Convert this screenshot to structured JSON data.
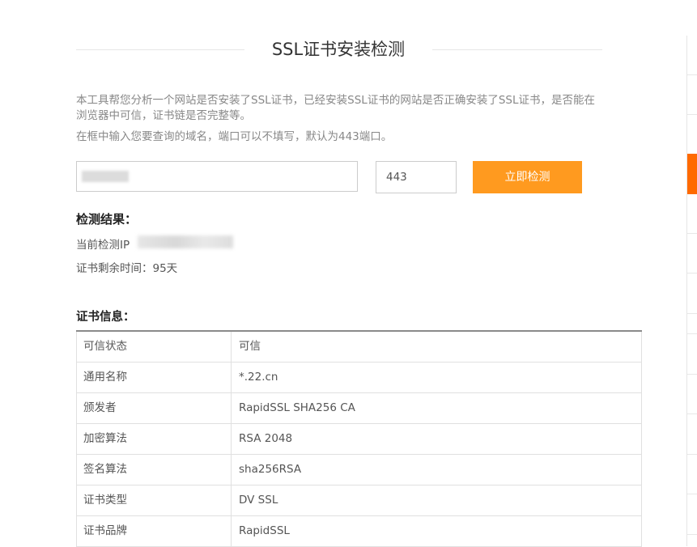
{
  "header": {
    "title": "SSL证书安装检测"
  },
  "intro": {
    "line1": "本工具帮您分析一个网站是否安装了SSL证书，已经安装SSL证书的网站是否正确安装了SSL证书，是否能在浏览器中可信，证书链是否完整等。",
    "line2": "在框中输入您要查询的域名，端口可以不填写，默认为443端口。"
  },
  "form": {
    "port_value": "443",
    "button_label": "立即检测"
  },
  "result": {
    "title": "检测结果：",
    "ip_label": "当前检测IP",
    "remaining": "证书剩余时间：95天"
  },
  "cert": {
    "title": "证书信息：",
    "rows": [
      {
        "key": "可信状态",
        "value": "可信"
      },
      {
        "key": "通用名称",
        "value": "*.22.cn"
      },
      {
        "key": "颁发者",
        "value": "RapidSSL SHA256 CA"
      },
      {
        "key": "加密算法",
        "value": "RSA 2048"
      },
      {
        "key": "签名算法",
        "value": "sha256RSA"
      },
      {
        "key": "证书类型",
        "value": "DV SSL"
      },
      {
        "key": "证书品牌",
        "value": "RapidSSL"
      }
    ]
  },
  "colors": {
    "accent": "#ff9a1f",
    "sidebar_active": "#ff6a00"
  }
}
